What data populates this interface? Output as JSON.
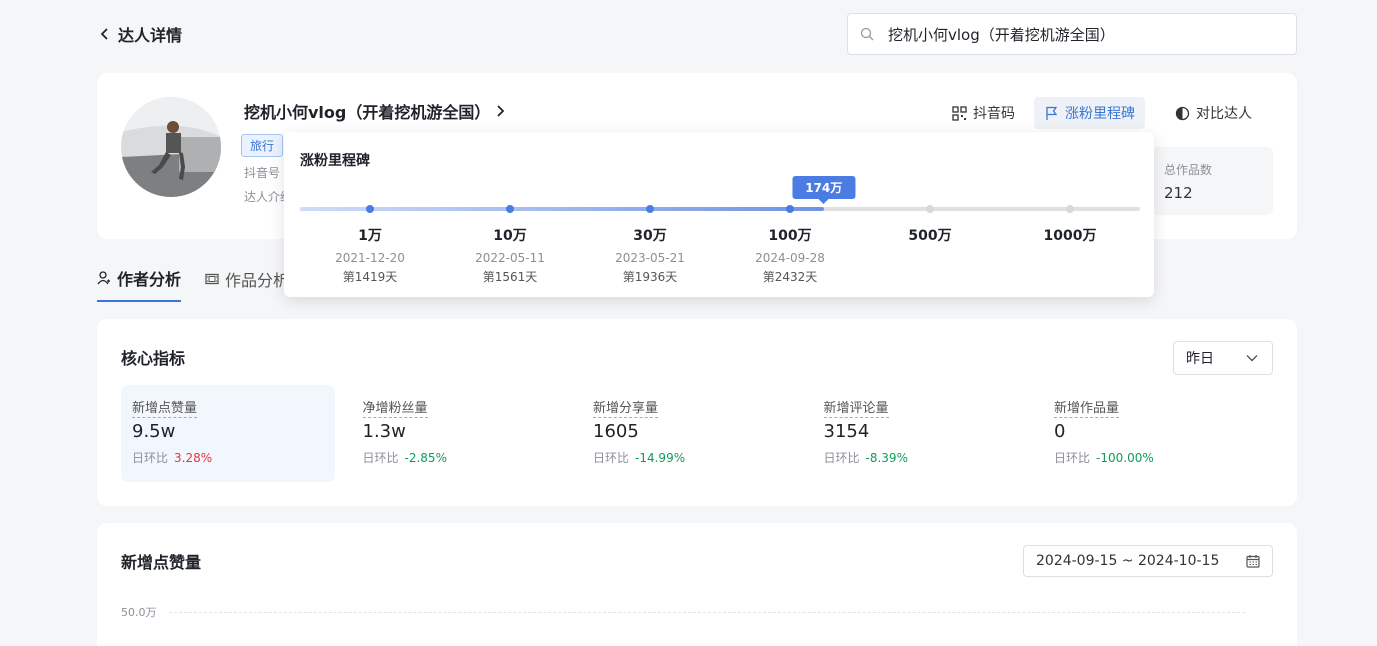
{
  "header": {
    "back_label": "达人详情",
    "search_value": "挖机小何vlog（开着挖机游全国）"
  },
  "profile": {
    "name": "挖机小何vlog（开着挖机游全国）",
    "tag": "旅行",
    "meta_line1": "抖音号",
    "meta_line2": "达人介绍",
    "actions": {
      "qr": "抖音码",
      "milestone": "涨粉里程碑",
      "compare": "对比达人"
    },
    "stat": {
      "label": "总作品数",
      "value": "212"
    }
  },
  "tabs": [
    {
      "label": "作者分析"
    },
    {
      "label": "作品分析"
    }
  ],
  "milestone_popup": {
    "title": "涨粉里程碑",
    "current": "174万",
    "progress_fraction": 0.6235,
    "items": [
      {
        "label": "1万",
        "date": "2021-12-20",
        "days": "第1419天",
        "reached": true
      },
      {
        "label": "10万",
        "date": "2022-05-11",
        "days": "第1561天",
        "reached": true
      },
      {
        "label": "30万",
        "date": "2023-05-21",
        "days": "第1936天",
        "reached": true
      },
      {
        "label": "100万",
        "date": "2024-09-28",
        "days": "第2432天",
        "reached": true
      },
      {
        "label": "500万",
        "date": "",
        "days": "",
        "reached": false
      },
      {
        "label": "1000万",
        "date": "",
        "days": "",
        "reached": false
      }
    ]
  },
  "core_metrics": {
    "title": "核心指标",
    "period": "昨日",
    "change_label": "日环比",
    "items": [
      {
        "label": "新增点赞量",
        "value": "9.5w",
        "change": "3.28%",
        "direction": "up"
      },
      {
        "label": "净增粉丝量",
        "value": "1.3w",
        "change": "-2.85%",
        "direction": "down"
      },
      {
        "label": "新增分享量",
        "value": "1605",
        "change": "-14.99%",
        "direction": "down"
      },
      {
        "label": "新增评论量",
        "value": "3154",
        "change": "-8.39%",
        "direction": "down"
      },
      {
        "label": "新增作品量",
        "value": "0",
        "change": "-100.00%",
        "direction": "down"
      }
    ]
  },
  "likes_chart": {
    "title": "新增点赞量",
    "date_range": "2024-09-15 ~ 2024-10-15",
    "y_tick_top": "50.0万"
  },
  "colors": {
    "accent": "#3a76d8",
    "up": "#e0373f",
    "down": "#0f9d58"
  }
}
